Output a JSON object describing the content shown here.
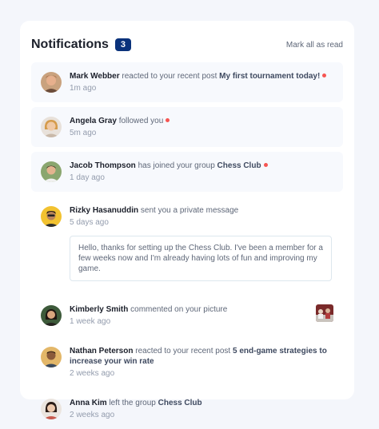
{
  "header": {
    "title": "Notifications",
    "count": "3",
    "mark_all": "Mark all as read"
  },
  "notifications": [
    {
      "name": "Mark Webber",
      "action": "reacted to your recent post",
      "target": "My first tournament today!",
      "time": "1m ago",
      "unread": true
    },
    {
      "name": "Angela Gray",
      "action": "followed you",
      "target": "",
      "time": "5m ago",
      "unread": true
    },
    {
      "name": "Jacob Thompson",
      "action": "has joined your group",
      "target": "Chess Club",
      "time": "1 day ago",
      "unread": true
    },
    {
      "name": "Rizky Hasanuddin",
      "action": "sent you a private message",
      "target": "",
      "time": "5 days ago",
      "unread": false,
      "message": "Hello, thanks for setting up the Chess Club. I've been a member for a few weeks now and I'm already having lots of fun and improving my game."
    },
    {
      "name": "Kimberly Smith",
      "action": "commented on your picture",
      "target": "",
      "time": "1 week ago",
      "unread": false
    },
    {
      "name": "Nathan Peterson",
      "action": "reacted to your recent post",
      "target": "5 end-game strategies to increase your win rate",
      "time": "2 weeks ago",
      "unread": false
    },
    {
      "name": "Anna Kim",
      "action": "left the group",
      "target": "Chess Club",
      "time": "2 weeks ago",
      "unread": false
    }
  ],
  "colors": {
    "accent": "#0a327b",
    "unread_dot": "#f65552",
    "unread_bg": "#f7f9fd"
  }
}
